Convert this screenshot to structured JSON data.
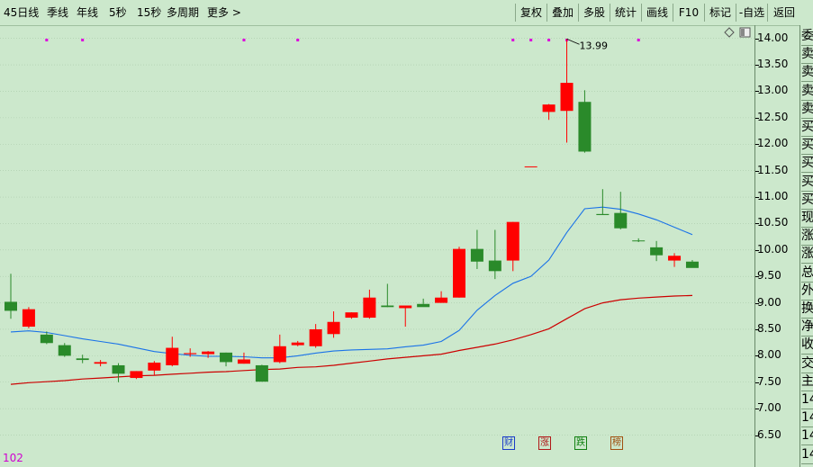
{
  "toolbar": {
    "left_items": [
      "45日线",
      "季线",
      "年线",
      "5秒",
      "15秒",
      "多周期",
      "更多 >"
    ],
    "right_buttons": [
      "复权",
      "叠加",
      "多股",
      "统计",
      "画线",
      "F10",
      "标记",
      "-自选",
      "返回"
    ]
  },
  "chart_data": {
    "type": "candlestick",
    "y_ticks": [
      "14.00",
      "13.50",
      "13.00",
      "12.50",
      "12.00",
      "11.50",
      "11.00",
      "10.50",
      "10.00",
      "9.50",
      "9.00",
      "8.50",
      "8.00",
      "7.50",
      "7.00",
      "6.50"
    ],
    "ylim": [
      6.22,
      14.25
    ],
    "annotation": "13.99",
    "candles": [
      {
        "o": 9.02,
        "h": 9.55,
        "l": 8.7,
        "c": 8.85
      },
      {
        "o": 8.55,
        "h": 8.92,
        "l": 8.52,
        "c": 8.88
      },
      {
        "o": 8.4,
        "h": 8.46,
        "l": 8.22,
        "c": 8.24
      },
      {
        "o": 8.2,
        "h": 8.24,
        "l": 7.98,
        "c": 8.0
      },
      {
        "o": 7.95,
        "h": 8.02,
        "l": 7.86,
        "c": 7.92
      },
      {
        "o": 7.85,
        "h": 7.92,
        "l": 7.8,
        "c": 7.88
      },
      {
        "o": 7.82,
        "h": 7.86,
        "l": 7.5,
        "c": 7.66
      },
      {
        "o": 7.58,
        "h": 7.71,
        "l": 7.56,
        "c": 7.71
      },
      {
        "o": 7.72,
        "h": 7.9,
        "l": 7.64,
        "c": 7.87
      },
      {
        "o": 7.82,
        "h": 8.36,
        "l": 7.8,
        "c": 8.15
      },
      {
        "o": 8.03,
        "h": 8.14,
        "l": 7.98,
        "c": 8.05
      },
      {
        "o": 8.03,
        "h": 8.09,
        "l": 7.96,
        "c": 8.08
      },
      {
        "o": 8.06,
        "h": 8.06,
        "l": 7.8,
        "c": 7.88
      },
      {
        "o": 7.85,
        "h": 8.06,
        "l": 7.85,
        "c": 7.93
      },
      {
        "o": 7.82,
        "h": 7.83,
        "l": 7.51,
        "c": 7.51
      },
      {
        "o": 7.88,
        "h": 8.4,
        "l": 7.86,
        "c": 8.18
      },
      {
        "o": 8.2,
        "h": 8.28,
        "l": 8.18,
        "c": 8.25
      },
      {
        "o": 8.18,
        "h": 8.6,
        "l": 8.15,
        "c": 8.5
      },
      {
        "o": 8.41,
        "h": 8.84,
        "l": 8.34,
        "c": 8.64
      },
      {
        "o": 8.72,
        "h": 8.82,
        "l": 8.7,
        "c": 8.82
      },
      {
        "o": 8.72,
        "h": 9.25,
        "l": 8.7,
        "c": 9.1
      },
      {
        "o": 8.95,
        "h": 9.36,
        "l": 8.92,
        "c": 8.92
      },
      {
        "o": 8.9,
        "h": 8.93,
        "l": 8.55,
        "c": 8.95
      },
      {
        "o": 8.98,
        "h": 9.08,
        "l": 8.98,
        "c": 8.92
      },
      {
        "o": 9.0,
        "h": 9.22,
        "l": 9.0,
        "c": 9.1
      },
      {
        "o": 9.1,
        "h": 10.06,
        "l": 9.1,
        "c": 10.02
      },
      {
        "o": 10.02,
        "h": 10.38,
        "l": 9.64,
        "c": 9.78
      },
      {
        "o": 9.8,
        "h": 10.38,
        "l": 9.45,
        "c": 9.6
      },
      {
        "o": 9.8,
        "h": 10.53,
        "l": 9.6,
        "c": 10.53
      },
      {
        "o": 11.58,
        "h": 11.58,
        "l": 11.58,
        "c": 11.58
      },
      {
        "o": 12.61,
        "h": 12.76,
        "l": 12.46,
        "c": 12.75
      },
      {
        "o": 12.63,
        "h": 13.99,
        "l": 12.03,
        "c": 13.16
      },
      {
        "o": 12.8,
        "h": 13.02,
        "l": 11.84,
        "c": 11.86
      },
      {
        "o": 10.68,
        "h": 11.15,
        "l": 10.66,
        "c": 10.66
      },
      {
        "o": 10.7,
        "h": 11.1,
        "l": 10.39,
        "c": 10.41
      },
      {
        "o": 10.18,
        "h": 10.22,
        "l": 10.15,
        "c": 10.17
      },
      {
        "o": 10.05,
        "h": 10.17,
        "l": 9.79,
        "c": 9.9
      },
      {
        "o": 9.8,
        "h": 9.94,
        "l": 9.68,
        "c": 9.89
      },
      {
        "o": 9.78,
        "h": 9.81,
        "l": 9.67,
        "c": 9.66
      }
    ],
    "ma_blue": [
      8.45,
      8.47,
      8.44,
      8.38,
      8.32,
      8.27,
      8.22,
      8.15,
      8.08,
      8.04,
      8.01,
      7.99,
      7.99,
      7.98,
      7.96,
      7.96,
      8.0,
      8.05,
      8.09,
      8.11,
      8.12,
      8.13,
      8.17,
      8.2,
      8.27,
      8.48,
      8.86,
      9.14,
      9.37,
      9.5,
      9.81,
      10.33,
      10.78,
      10.81,
      10.77,
      10.68,
      10.57,
      10.43,
      10.29
    ],
    "ma_red": [
      7.46,
      7.49,
      7.51,
      7.53,
      7.56,
      7.58,
      7.6,
      7.62,
      7.63,
      7.65,
      7.67,
      7.69,
      7.7,
      7.72,
      7.74,
      7.75,
      7.78,
      7.79,
      7.82,
      7.86,
      7.9,
      7.94,
      7.97,
      8.0,
      8.03,
      8.1,
      8.16,
      8.22,
      8.3,
      8.4,
      8.51,
      8.7,
      8.89,
      9.0,
      9.06,
      9.09,
      9.11,
      9.13,
      9.14
    ],
    "top_markers": [
      2,
      4,
      13,
      16,
      28,
      29,
      30,
      31,
      35
    ]
  },
  "bottom": {
    "value_label": "102",
    "badges": [
      {
        "char": "财",
        "color": "#1a3cc8"
      },
      {
        "char": "涨",
        "color": "#b01818"
      },
      {
        "char": "跌",
        "color": "#108010"
      },
      {
        "char": "榜",
        "color": "#a05010"
      }
    ]
  },
  "side_panel": {
    "labels": [
      "委",
      "卖",
      "卖",
      "卖",
      "卖",
      "买",
      "买",
      "买",
      "买",
      "买",
      "现",
      "涨",
      "涨",
      "总",
      "外",
      "换",
      "净",
      "收",
      "交",
      "主",
      "14",
      "14",
      "14",
      "14"
    ]
  },
  "icons": {
    "diamond": "diamond-icon",
    "window": "window-icon"
  }
}
